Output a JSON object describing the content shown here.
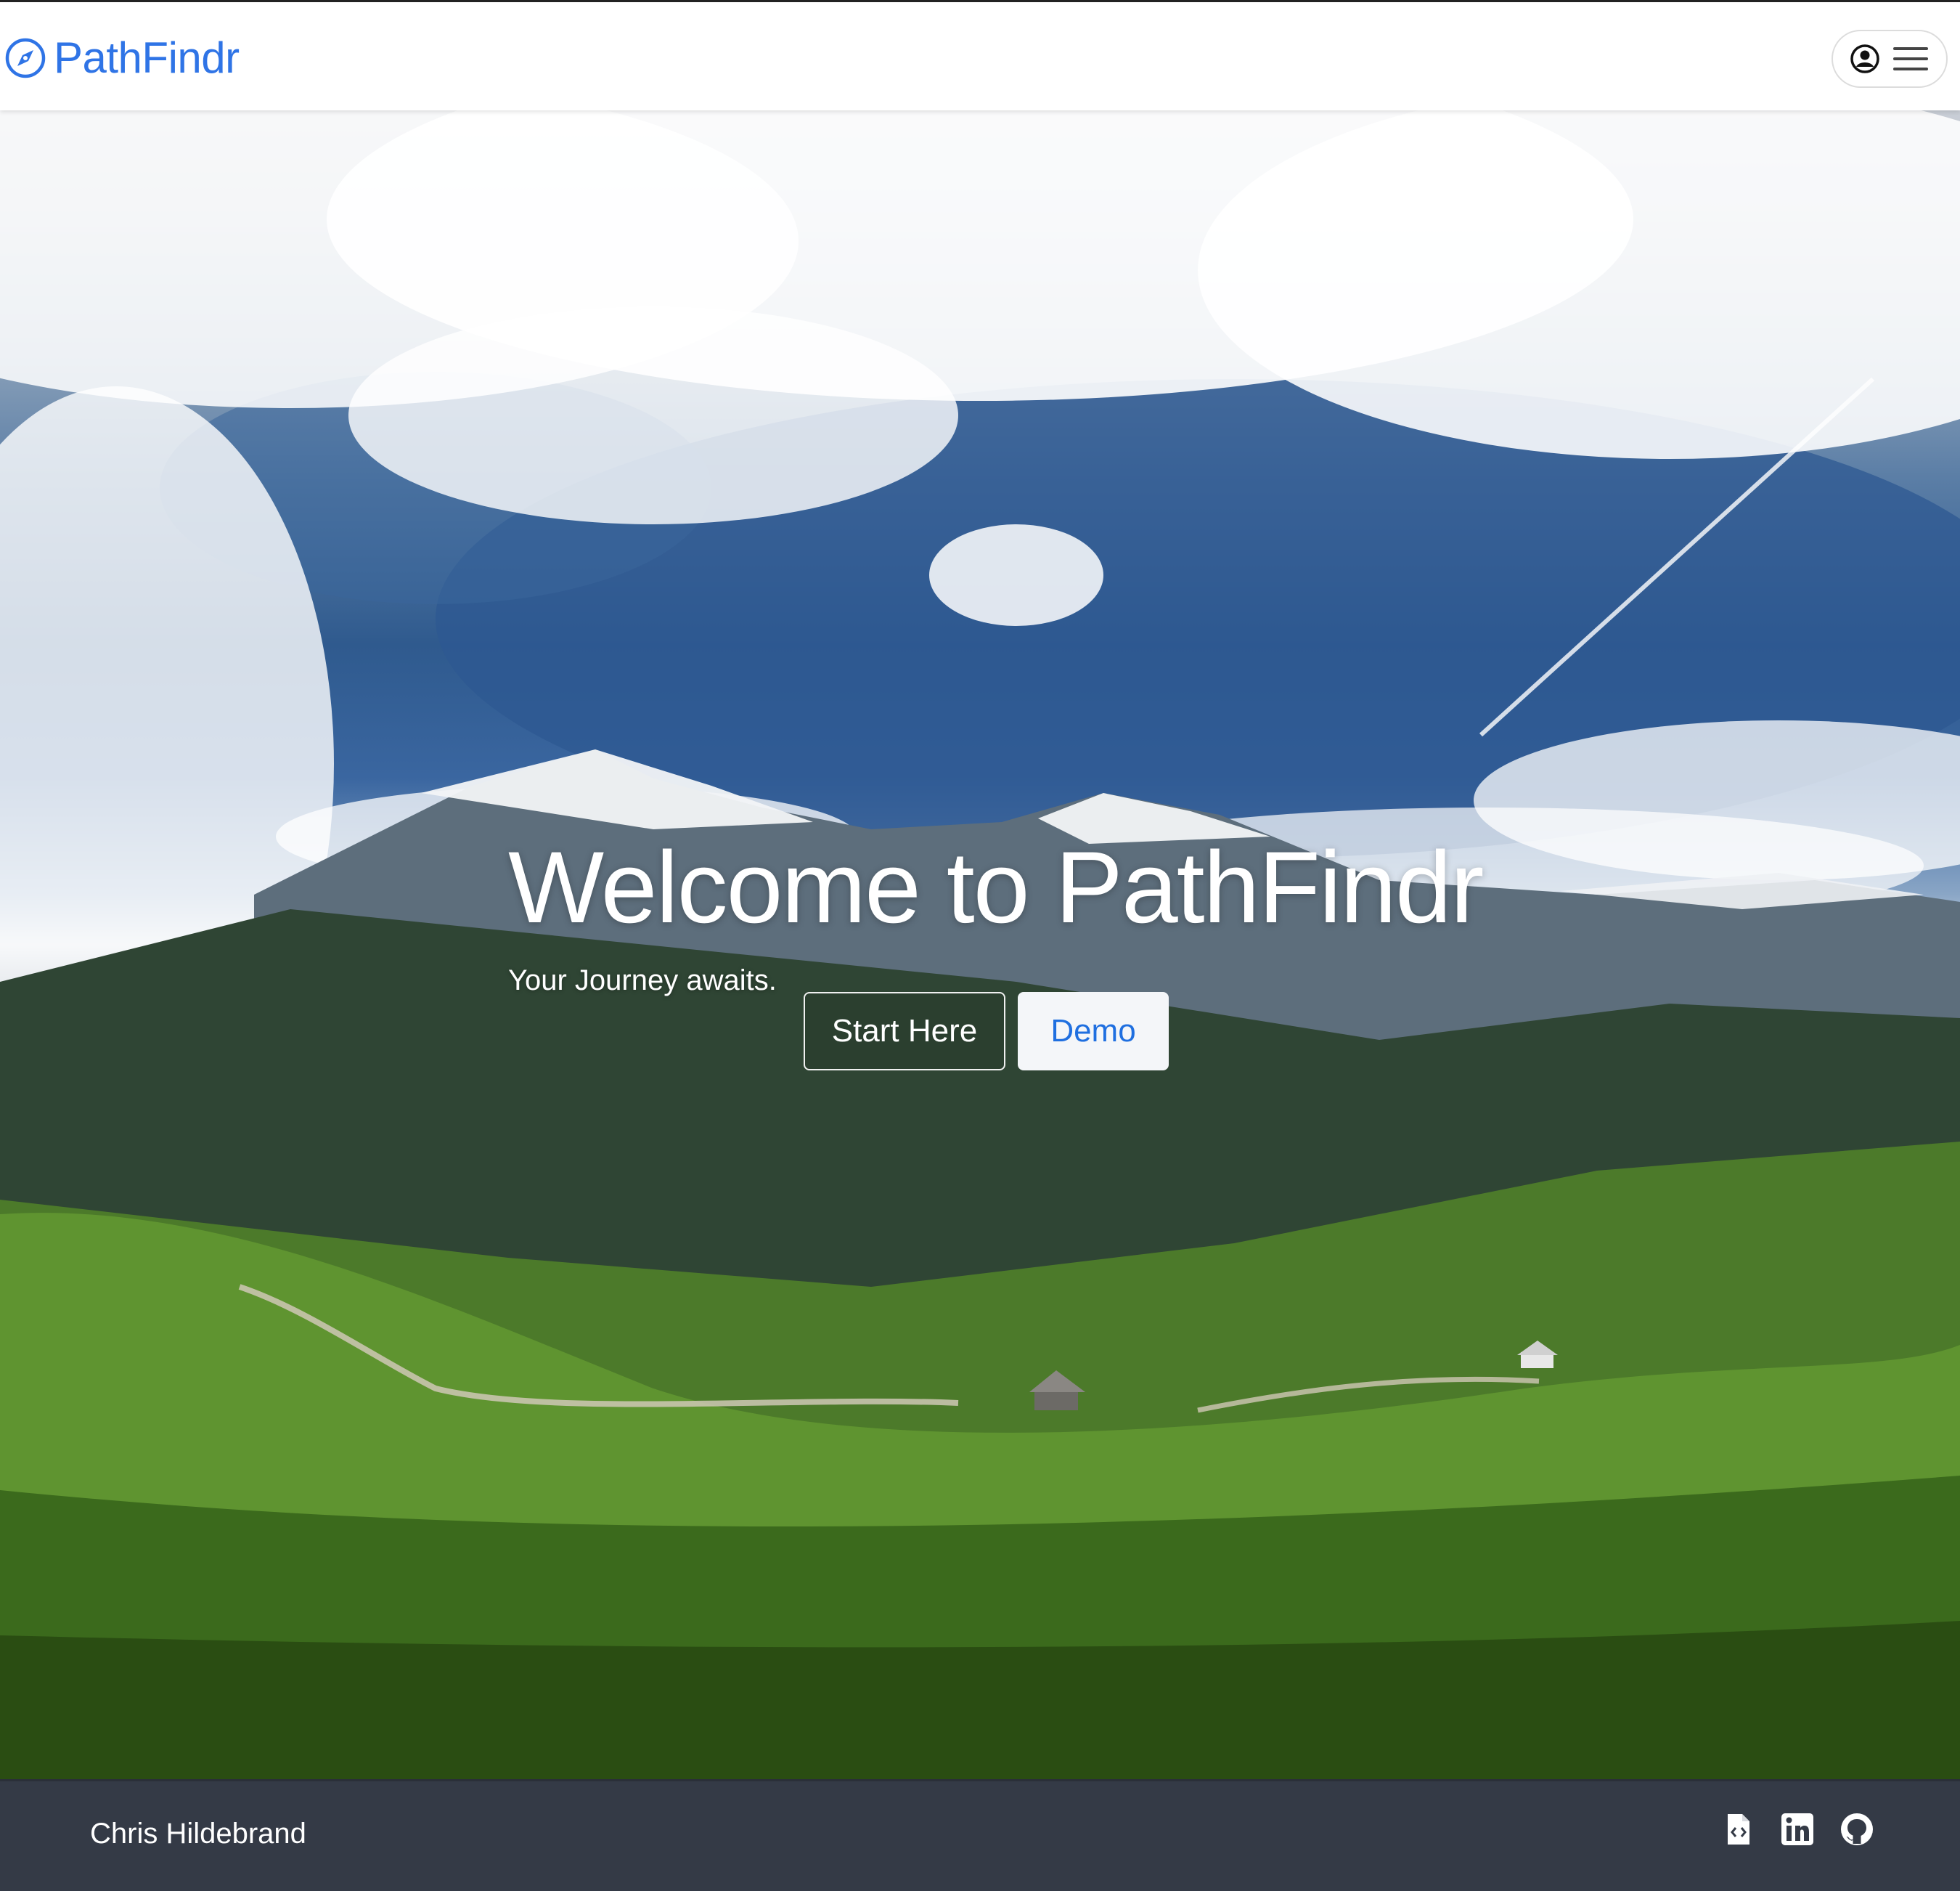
{
  "navbar": {
    "brand": "PathFindr",
    "brand_color": "#2f74e6",
    "brand_icon": "compass-icon",
    "user_menu_icons": [
      "user-circle-icon",
      "hamburger-menu-icon"
    ]
  },
  "hero": {
    "title": "Welcome to PathFindr",
    "subtitle": "Your Journey awaits.",
    "buttons": {
      "start_label": "Start Here",
      "demo_label": "Demo"
    },
    "background": "mountain-valley-landscape-photo"
  },
  "footer": {
    "author": "Chris Hildebrand",
    "background_color": "#343a46",
    "icons": [
      "file-code-icon",
      "linkedin-icon",
      "github-icon"
    ]
  }
}
